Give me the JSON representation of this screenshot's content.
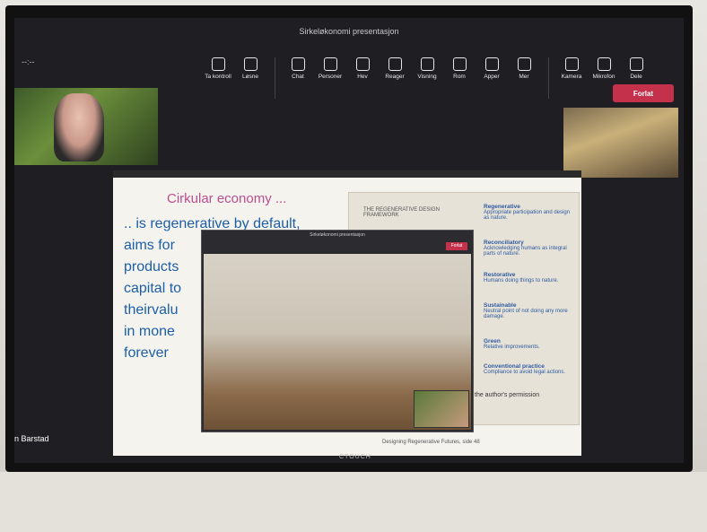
{
  "window": {
    "title": "Sirkeløkonomi presentasjon",
    "timer": "--:--"
  },
  "toolbar": [
    {
      "label": "Ta kontroll",
      "icon": "take-control-icon"
    },
    {
      "label": "Løsne",
      "icon": "popout-icon"
    },
    {
      "label": "Chat",
      "icon": "chat-icon"
    },
    {
      "label": "Personer",
      "icon": "people-icon"
    },
    {
      "label": "Hev",
      "icon": "raise-hand-icon"
    },
    {
      "label": "Reager",
      "icon": "react-icon"
    },
    {
      "label": "Visning",
      "icon": "view-icon"
    },
    {
      "label": "Rom",
      "icon": "rooms-icon"
    },
    {
      "label": "Apper",
      "icon": "apps-icon"
    },
    {
      "label": "Mer",
      "icon": "more-icon"
    },
    {
      "label": "Kamera",
      "icon": "camera-icon"
    },
    {
      "label": "Mikrofon",
      "icon": "mic-icon"
    },
    {
      "label": "Dele",
      "icon": "share-icon"
    }
  ],
  "leave_label": "Forlat",
  "slide": {
    "heading": "Cirkular economy ...",
    "lines": [
      ".. is regenerative by default,",
      "aims for",
      "products",
      "capital to",
      "theirvalu",
      "in mone",
      "forever"
    ],
    "diagram": {
      "title": "THE REGENERATIVE DESIGN FRAMEWORK",
      "levels": [
        {
          "name": "Regenerative",
          "desc": "Appropriate participation and design as nature."
        },
        {
          "name": "Reconciliatory",
          "desc": "Acknowledging humans as integral parts of nature."
        },
        {
          "name": "Restorative",
          "desc": "Humans doing things to nature."
        },
        {
          "name": "Sustainable",
          "desc": "Neutral point of not doing any more damage."
        },
        {
          "name": "Green",
          "desc": "Relative improvements."
        },
        {
          "name": "Conventional practice",
          "desc": "Compliance to avoid legal actions."
        }
      ],
      "footer": "the author's permission",
      "source": "Designing Regenerative Futures, side 48"
    }
  },
  "inner_meeting": {
    "title": "Sirkeløkonomi presentasjon",
    "leave_label": "Forlat"
  },
  "participant_name": "n Barstad",
  "brand": "CTOUCH"
}
